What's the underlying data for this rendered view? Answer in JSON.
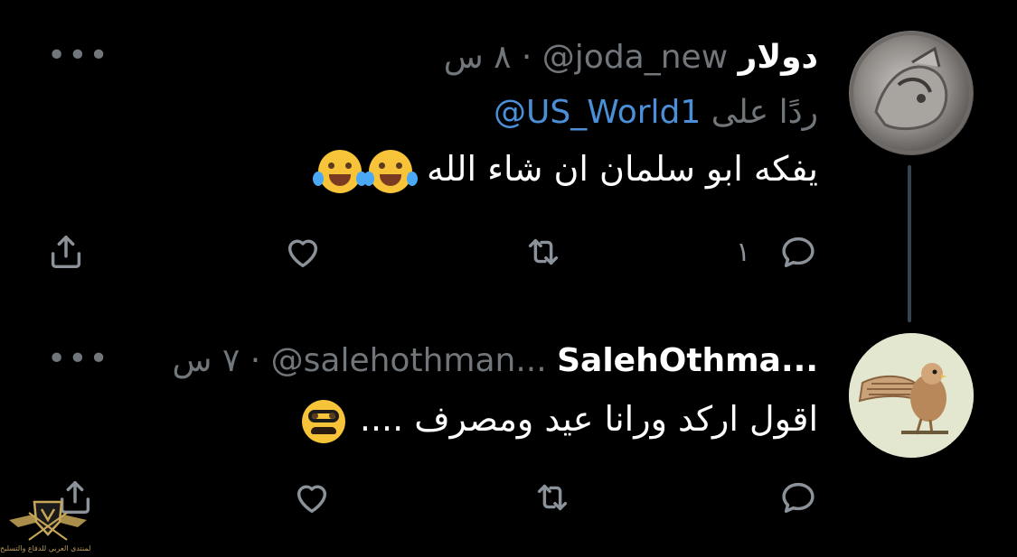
{
  "thread": {
    "tweets": [
      {
        "display_name": "دولار",
        "handle": "@joda_new",
        "separator": "·",
        "time": "٨ س",
        "reply_label": "ردًا على",
        "reply_handle": "@US_World1",
        "text": "يفكه ابو سلمان ان شاء الله",
        "emojis": [
          "face-with-tears-of-joy",
          "face-with-tears-of-joy"
        ],
        "actions": {
          "reply_count": "١",
          "retweet_count": "",
          "like_count": ""
        },
        "more_label": "•••"
      },
      {
        "display_name": "SalehOthma...",
        "handle": "@salehothman...",
        "separator": "·",
        "time": "٧ س",
        "text": "اقول اركد ورانا عيد ومصرف ....",
        "emojis": [
          "disguised-face"
        ],
        "actions": {
          "reply_count": "",
          "retweet_count": "",
          "like_count": ""
        },
        "more_label": "•••"
      }
    ]
  },
  "icons": {
    "reply": "reply-icon",
    "retweet": "retweet-icon",
    "like": "heart-icon",
    "share": "share-icon",
    "more": "more-icon"
  },
  "watermark": {
    "text": "المنتدى العربي للدفاع والتسليح"
  },
  "colors": {
    "background": "#000000",
    "primary_text": "#ffffff",
    "secondary_text": "#71767b",
    "link": "#4a8fd8",
    "thread_line": "#38444d",
    "icon": "#8b9299"
  }
}
